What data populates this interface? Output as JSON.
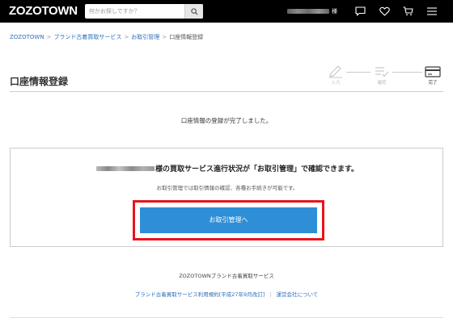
{
  "header": {
    "logo": "ZOZOTOWN",
    "search_placeholder": "何かお探しですか？",
    "honorific": "様",
    "icons": [
      "search-icon",
      "chat-icon",
      "heart-icon",
      "cart-icon",
      "menu-icon"
    ]
  },
  "breadcrumb": {
    "items": [
      "ZOZOTOWN",
      "ブランド古着買取サービス",
      "お取引管理",
      "口座情報登録"
    ],
    "separator": ">"
  },
  "page": {
    "title": "口座情報登録"
  },
  "steps": [
    {
      "label": "入力",
      "icon": "pencil-icon",
      "state": "done"
    },
    {
      "label": "確認",
      "icon": "checklist-icon",
      "state": "done"
    },
    {
      "label": "完了",
      "icon": "card-icon",
      "state": "current"
    }
  ],
  "complete": {
    "message": "口座情報の登録が完了しました。"
  },
  "notice": {
    "heading": "様の買取サービス進行状況が「お取引管理」で確認できます。",
    "sub": "お取引管理では取引情報の確認、各種お手続きが可能です。",
    "button_label": "お取引管理へ"
  },
  "footer": {
    "title": "ZOZOTOWNブランド古着買取サービス",
    "links": [
      "ブランド古着買取サービス利用規約[平成27年9月改訂]",
      "運営会社について"
    ]
  },
  "colors": {
    "header_bg": "#000000",
    "link": "#2a6fbb",
    "button": "#2f8fd6",
    "highlight": "#e8141d",
    "step_active": "#3a3a3a",
    "step_inactive": "#c8c8c8"
  }
}
